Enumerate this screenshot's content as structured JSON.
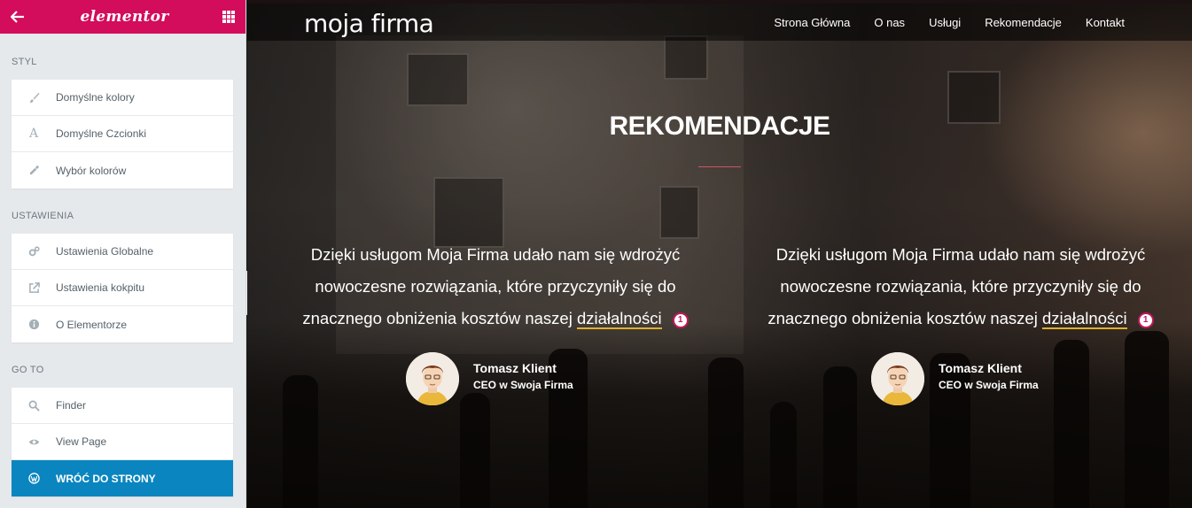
{
  "sidebar": {
    "logo": "elementor",
    "sections": [
      {
        "title": "STYL",
        "items": [
          {
            "label": "Domyślne kolory",
            "icon": "paintbrush-icon"
          },
          {
            "label": "Domyślne Czcionki",
            "icon": "font-icon"
          },
          {
            "label": "Wybór kolorów",
            "icon": "eyedropper-icon"
          }
        ]
      },
      {
        "title": "USTAWIENIA",
        "items": [
          {
            "label": "Ustawienia Globalne",
            "icon": "cogs-icon"
          },
          {
            "label": "Ustawienia kokpitu",
            "icon": "external-link-icon"
          },
          {
            "label": "O Elementorze",
            "icon": "info-icon"
          }
        ]
      },
      {
        "title": "GO TO",
        "items": [
          {
            "label": "Finder",
            "icon": "search-icon"
          },
          {
            "label": "View Page",
            "icon": "eye-icon"
          },
          {
            "label": "WRÓĆ DO STRONY",
            "icon": "wordpress-icon",
            "active": true
          }
        ]
      }
    ],
    "accent": "#d30c5c",
    "active_color": "#0a85bf"
  },
  "site": {
    "brand": "moja firma",
    "menu": [
      "Strona Główna",
      "O nas",
      "Usługi",
      "Rekomendacje",
      "Kontakt"
    ],
    "heading": "REKOMENDACJE",
    "testimonials": [
      {
        "quote_main": "Dzięki usługom Moja Firma udało nam się wdrożyć nowoczesne rozwiązania, które przyczyniły się do znacznego obniżenia kosztów naszej ",
        "quote_highlight": "działalności",
        "badge": "1",
        "name": "Tomasz Klient",
        "role": "CEO w Swoja Firma"
      },
      {
        "quote_main": "Dzięki usługom Moja Firma udało nam się wdrożyć nowoczesne rozwiązania, które przyczyniły się do znacznego obniżenia kosztów naszej ",
        "quote_highlight": "działalności",
        "badge": "1",
        "name": "Tomasz Klient",
        "role": "CEO w Swoja Firma"
      }
    ]
  }
}
